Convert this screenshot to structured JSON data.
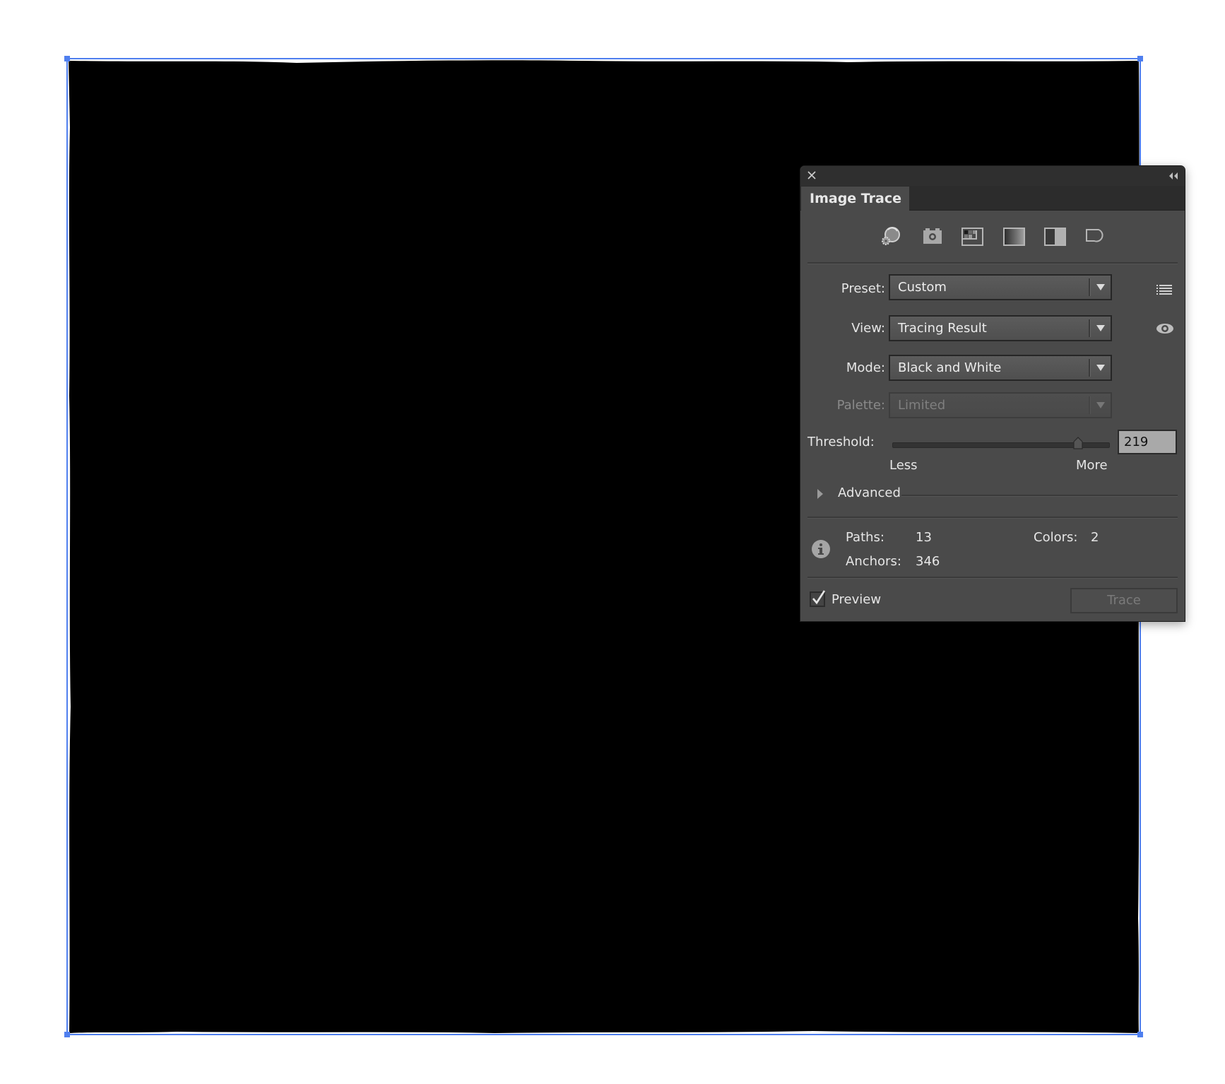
{
  "canvas": {
    "selection_color": "#4f7fef",
    "fill_color": "#000000"
  },
  "panel": {
    "tab_title": "Image Trace",
    "icons": [
      {
        "name": "auto-color-preset-icon",
        "title": "Auto-Color"
      },
      {
        "name": "high-color-preset-icon",
        "title": "High Color"
      },
      {
        "name": "low-color-preset-icon",
        "title": "Low Color"
      },
      {
        "name": "grayscale-preset-icon",
        "title": "Grayscale"
      },
      {
        "name": "black-and-white-preset-icon",
        "title": "Black and White"
      },
      {
        "name": "outline-preset-icon",
        "title": "Outline"
      }
    ],
    "preset": {
      "label": "Preset:",
      "value": "Custom"
    },
    "view": {
      "label": "View:",
      "value": "Tracing Result"
    },
    "mode": {
      "label": "Mode:",
      "value": "Black and White"
    },
    "palette": {
      "label": "Palette:",
      "value": "Limited",
      "disabled": true
    },
    "threshold": {
      "label": "Threshold:",
      "value": "219",
      "min": 0,
      "max": 255,
      "less_label": "Less",
      "more_label": "More"
    },
    "advanced": {
      "label": "Advanced",
      "expanded": false
    },
    "info": {
      "paths_label": "Paths:",
      "paths_value": "13",
      "colors_label": "Colors:",
      "colors_value": "2",
      "anchors_label": "Anchors:",
      "anchors_value": "346"
    },
    "preview": {
      "label": "Preview",
      "checked": true
    },
    "trace_button": {
      "label": "Trace",
      "disabled": true
    }
  }
}
